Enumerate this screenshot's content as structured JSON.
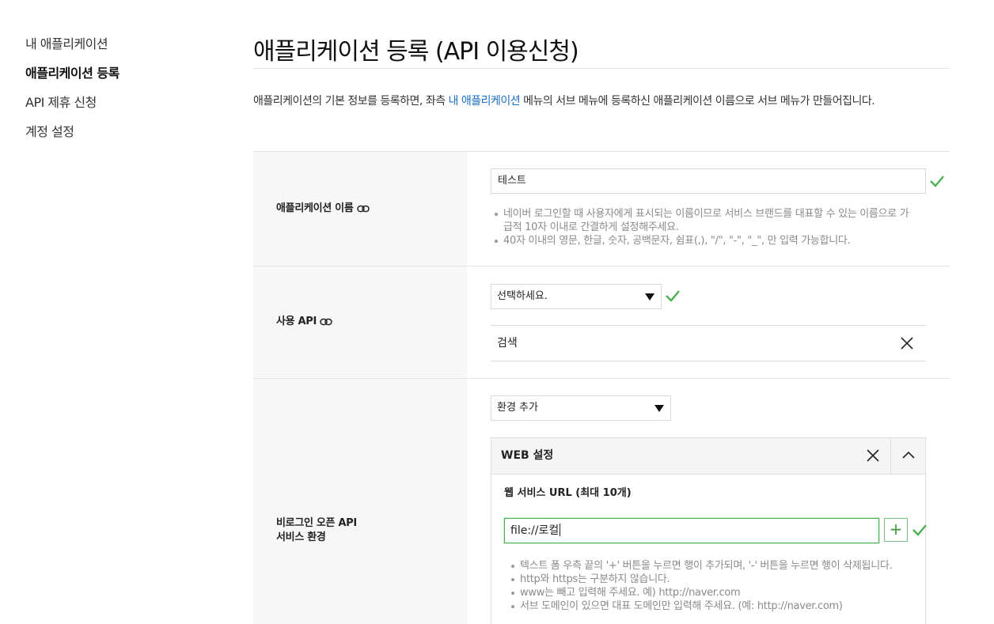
{
  "sidebar": {
    "items": [
      {
        "label": "내 애플리케이션"
      },
      {
        "label": "애플리케이션 등록"
      },
      {
        "label": "API 제휴 신청"
      },
      {
        "label": "계정 설정"
      }
    ]
  },
  "main": {
    "title": "애플리케이션 등록 (API 이용신청)",
    "intro_before": "애플리케이션의 기본 정보를 등록하면, 좌측 ",
    "intro_link": "내 애플리케이션",
    "intro_after": " 메뉴의 서브 메뉴에 등록하신 애플리케이션 이름으로 서브 메뉴가 만들어집니다."
  },
  "form": {
    "app_name": {
      "label": "애플리케이션 이름",
      "value": "테스트",
      "notes": [
        "네이버 로그인할 때 사용자에게 표시되는 이름이므로 서비스 브랜드를 대표할 수 있는 이름으로 가급적 10자 이내로 간결하게 설정해주세요.",
        "40자 이내의 영문, 한글, 숫자, 공백문자, 쉼표(,), \"/\", \"-\", \"_\", 만 입력 가능합니다."
      ]
    },
    "api": {
      "label": "사용 API",
      "select_value": "선택하세요.",
      "selected_item": "검색"
    },
    "env": {
      "label_line1": "비로그인 오픈 API",
      "label_line2": "서비스 환경",
      "select_value": "환경 추가",
      "panel_title": "WEB 설정",
      "url_label": "웹 서비스 URL (최대 10개)",
      "url_value": "file://로컬",
      "plus_label": "+",
      "notes": [
        "텍스트 폼 우측 끝의 '+' 버튼을 누르면 행이 추가되며, '-' 버튼을 누르면 행이 삭제됩니다.",
        "http와 https는 구분하지 않습니다.",
        "www는 빼고 입력해 주세요. 예) http://naver.com",
        "서브 도메인이 있으면 대표 도메인만 입력해 주세요. (예: http://naver.com)"
      ]
    }
  },
  "colors": {
    "check": "#4caf50",
    "link": "#1a6fc4",
    "label_bg": "#f7f7f7"
  }
}
